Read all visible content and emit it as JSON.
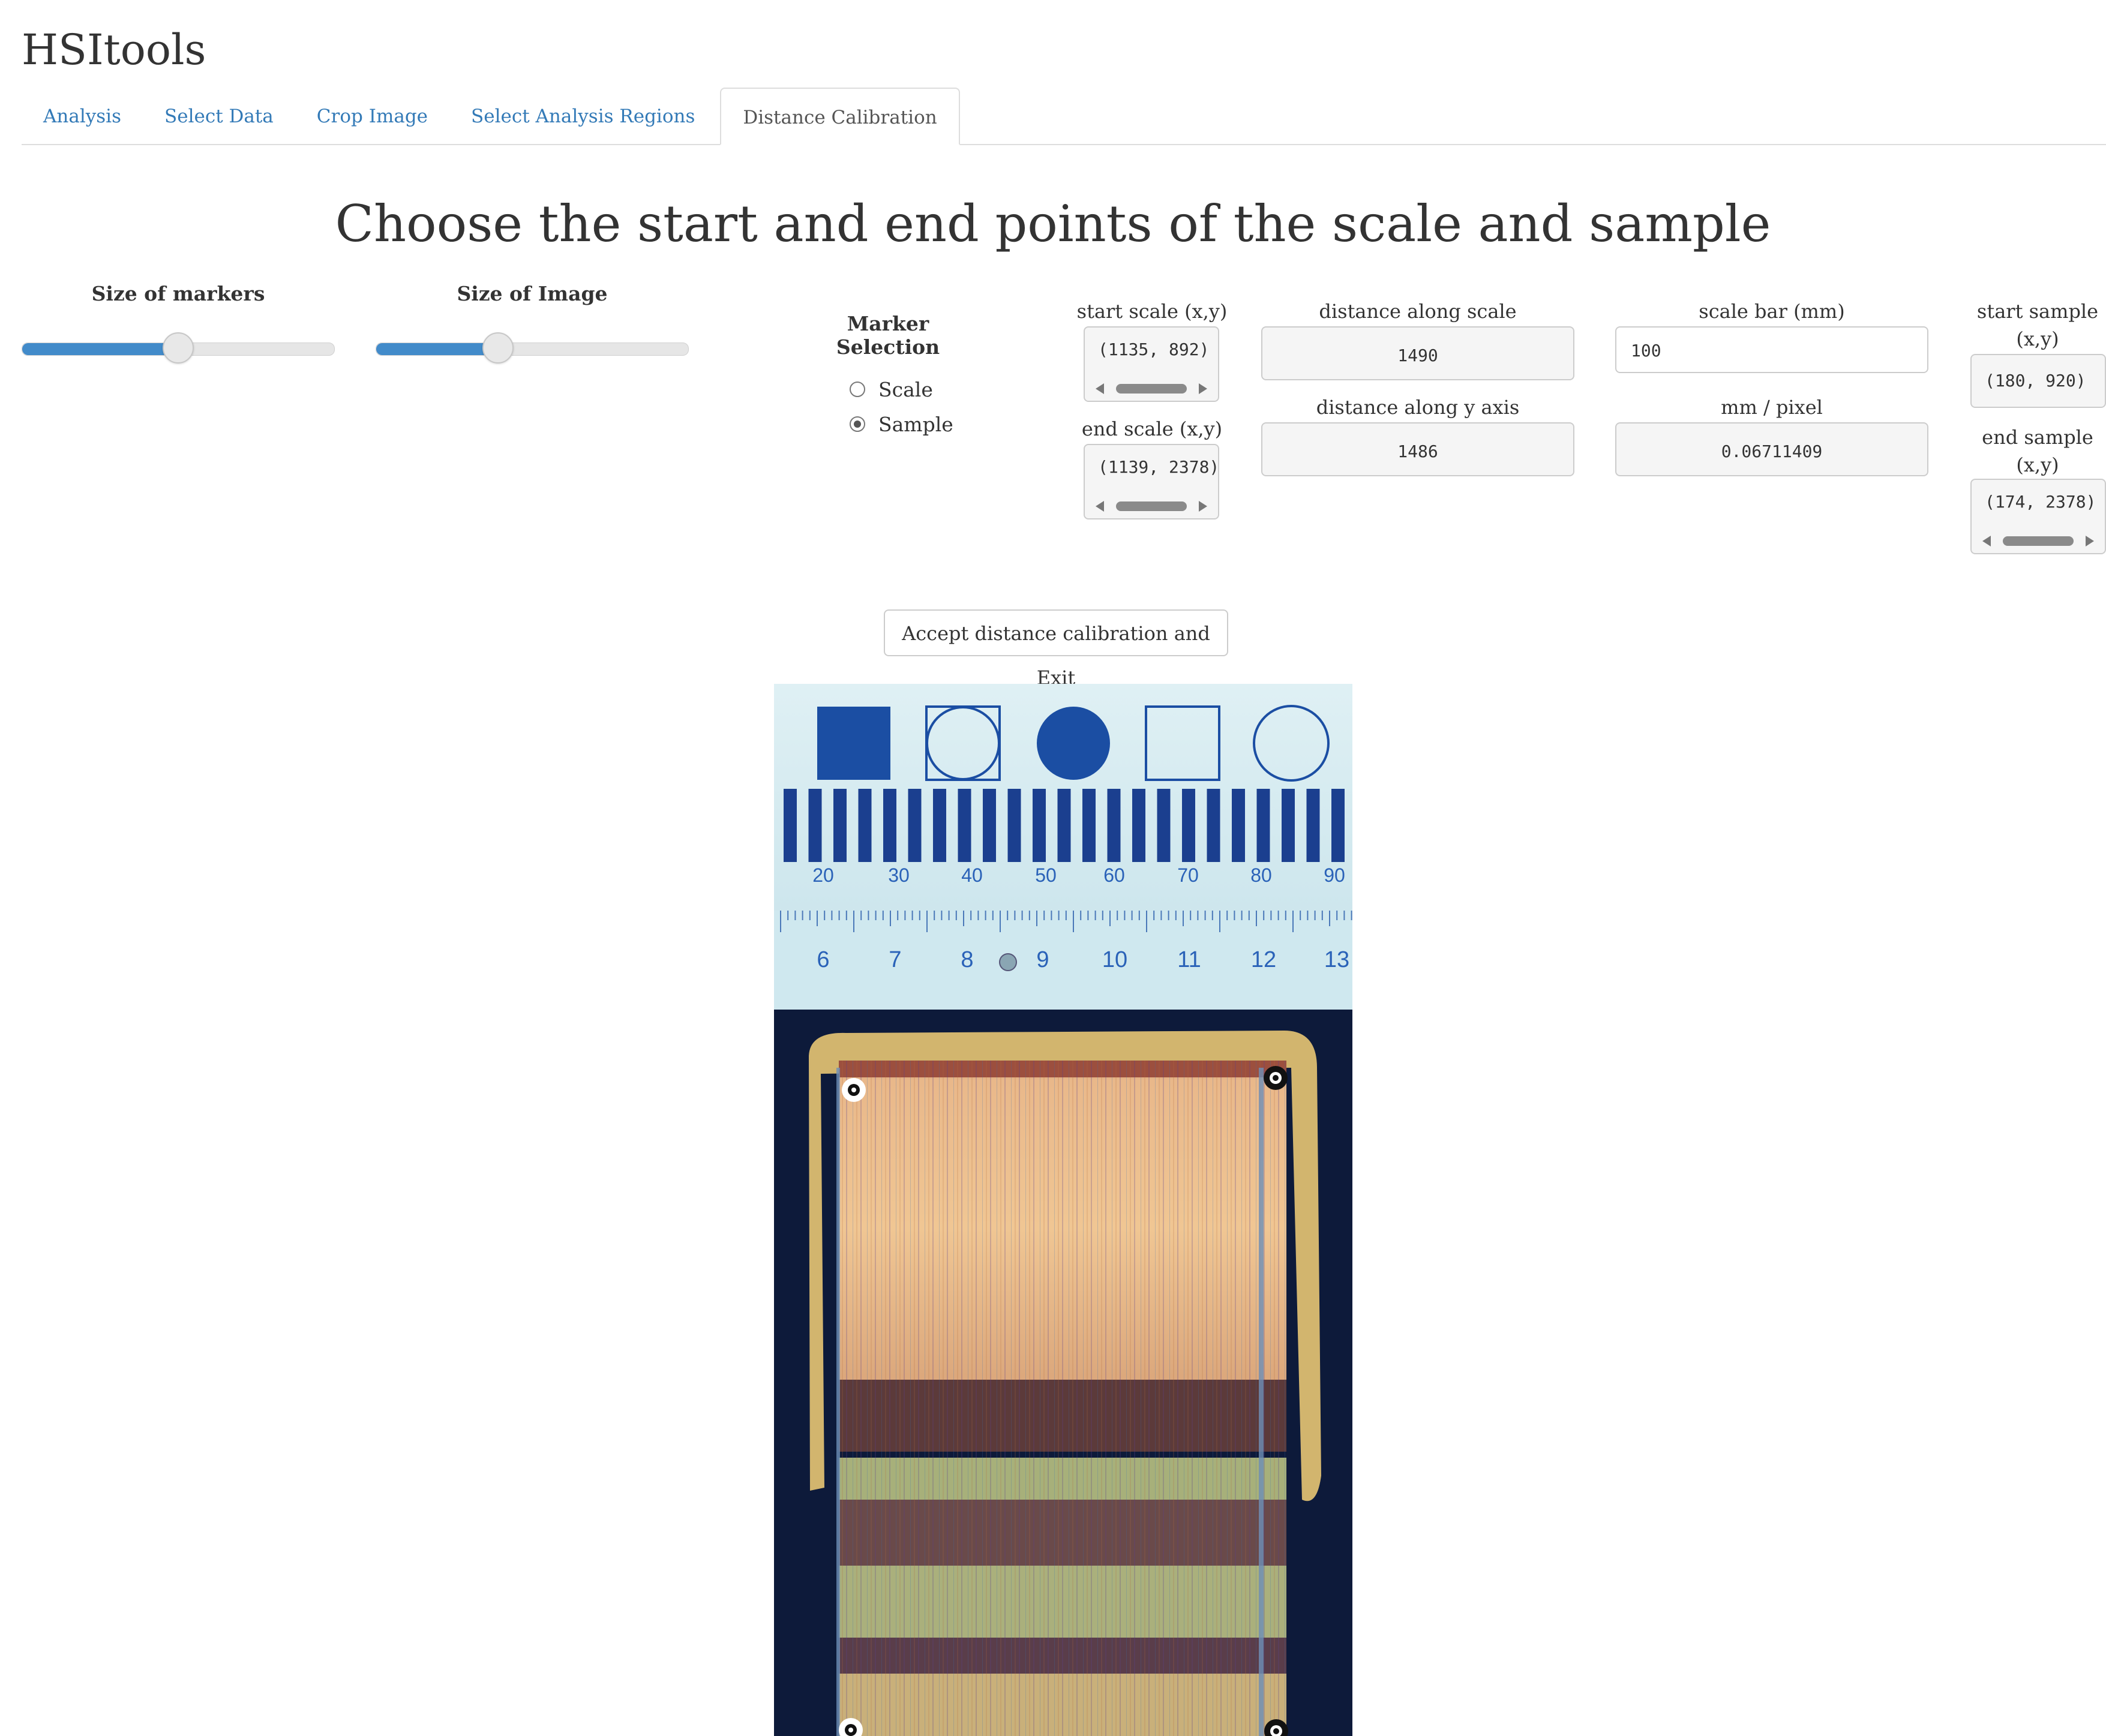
{
  "app": {
    "title": "HSItools"
  },
  "tabs": [
    {
      "label": "Analysis",
      "active": false
    },
    {
      "label": "Select Data",
      "active": false
    },
    {
      "label": "Crop Image",
      "active": false
    },
    {
      "label": "Select Analysis Regions",
      "active": false
    },
    {
      "label": "Distance Calibration",
      "active": true
    }
  ],
  "page": {
    "heading": "Choose the start and end points of the scale and sample"
  },
  "controls": {
    "marker_size": {
      "label": "Size of markers",
      "value_fraction": 0.5
    },
    "image_size": {
      "label": "Size of Image",
      "value_fraction": 0.39
    },
    "marker_selection": {
      "label": "Marker Selection",
      "options": [
        "Scale",
        "Sample"
      ],
      "selected": "Sample"
    }
  },
  "fields": {
    "start_scale": {
      "label": "start scale (x,y)",
      "value": "(1135, 892)"
    },
    "end_scale": {
      "label": "end scale (x,y)",
      "value": "(1139, 2378)"
    },
    "distance_along_scale": {
      "label": "distance along scale",
      "value": "1490"
    },
    "distance_along_y": {
      "label": "distance along y axis",
      "value": "1486"
    },
    "scale_bar": {
      "label": "scale bar (mm)",
      "value": "100"
    },
    "mm_per_pixel": {
      "label": "mm / pixel",
      "value": "0.06711409"
    },
    "start_sample": {
      "label": "start sample (x,y)",
      "value": "(180, 920)"
    },
    "end_sample": {
      "label": "end sample (x,y)",
      "value": "(174, 2378)"
    }
  },
  "accept_button": {
    "label": "Accept distance calibration and Exit"
  },
  "image": {
    "ruler_top_numbers": [
      "20",
      "30",
      "40",
      "50",
      "60",
      "70",
      "80",
      "90"
    ],
    "ruler_bottom_numbers": [
      "6",
      "7",
      "8",
      "9",
      "10",
      "11",
      "12",
      "13"
    ]
  },
  "colors": {
    "accent": "#428bca",
    "link": "#337ab7",
    "scale_blue": "#1b4ea3"
  }
}
